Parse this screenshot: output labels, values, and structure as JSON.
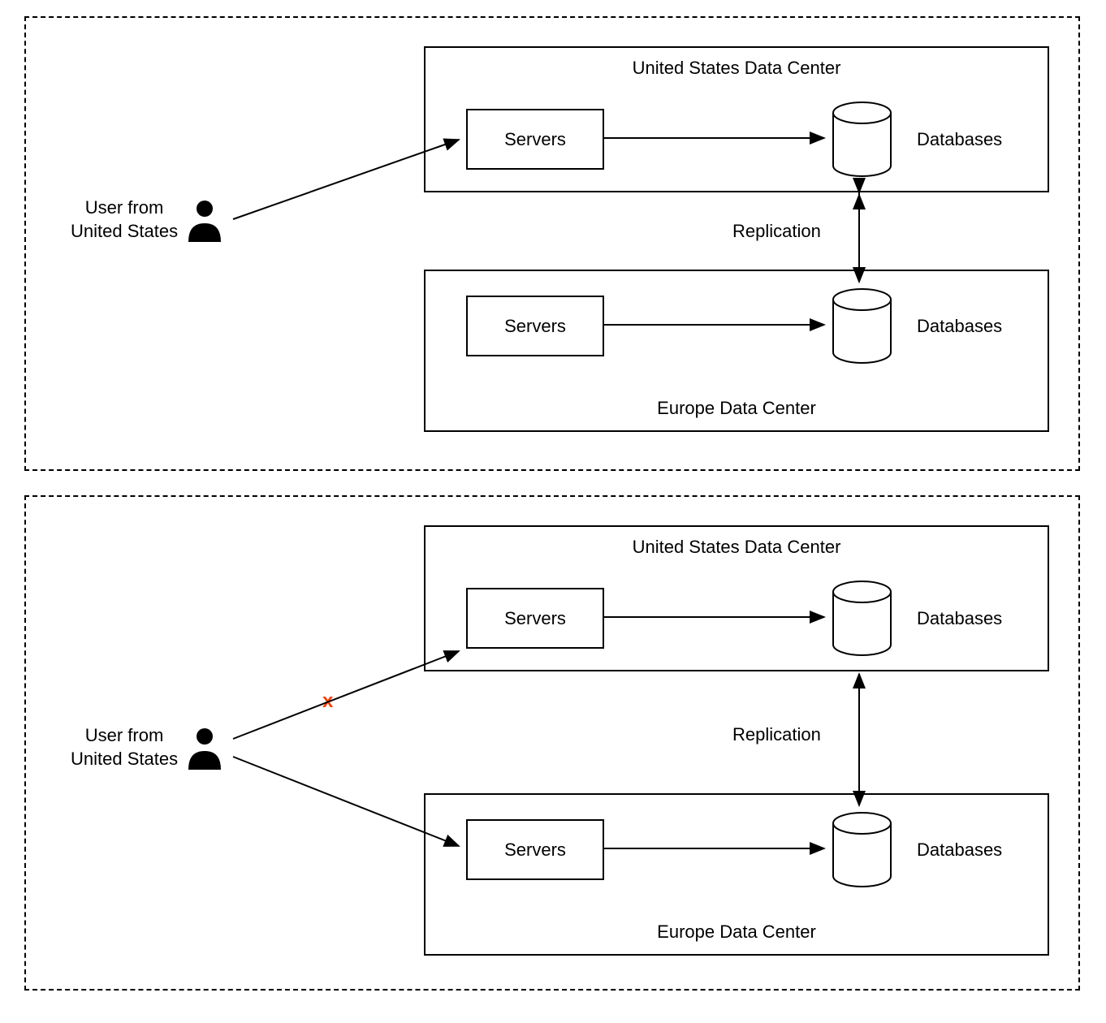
{
  "panels": [
    {
      "user_label_line1": "User from",
      "user_label_line2": "United States",
      "dc_top": {
        "title": "United States Data Center",
        "servers": "Servers",
        "databases": "Databases"
      },
      "dc_bottom": {
        "title": "Europe Data Center",
        "servers": "Servers",
        "databases": "Databases"
      },
      "replication": "Replication",
      "failed_connection": false
    },
    {
      "user_label_line1": "User from",
      "user_label_line2": "United States",
      "dc_top": {
        "title": "United States Data Center",
        "servers": "Servers",
        "databases": "Databases"
      },
      "dc_bottom": {
        "title": "Europe Data Center",
        "servers": "Servers",
        "databases": "Databases"
      },
      "replication": "Replication",
      "failed_connection": true,
      "x_mark": "x"
    }
  ]
}
